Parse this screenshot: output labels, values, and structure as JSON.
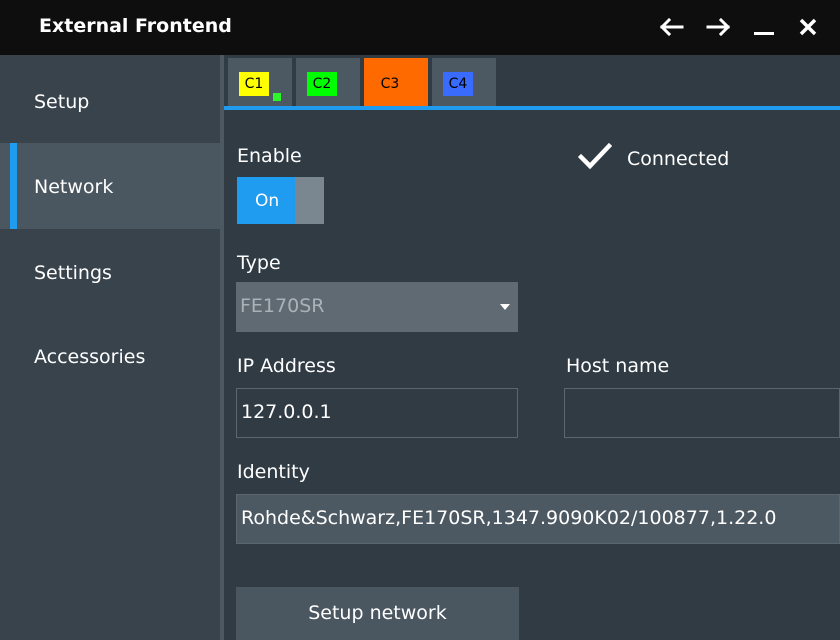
{
  "window": {
    "title": "External Frontend"
  },
  "titlebar_icons": [
    "arrow-left-icon",
    "arrow-right-icon",
    "minimize-icon",
    "close-icon"
  ],
  "sidebar": {
    "items": [
      {
        "label": "Setup",
        "active": false
      },
      {
        "label": "Network",
        "active": true
      },
      {
        "label": "Settings",
        "active": false
      },
      {
        "label": "Accessories",
        "active": false
      }
    ]
  },
  "tabs": [
    {
      "label": "C1",
      "color": "#ffff00",
      "active": false
    },
    {
      "label": "C2",
      "color": "#00ff00",
      "active": false
    },
    {
      "label": "C3",
      "color": "#ff6a00",
      "active": true
    },
    {
      "label": "C4",
      "color": "#3a6bff",
      "active": false
    }
  ],
  "form": {
    "enable_label": "Enable",
    "toggle_value": "On",
    "status_text": "Connected",
    "type_label": "Type",
    "type_value": "FE170SR",
    "ip_label": "IP Address",
    "ip_value": "127.0.0.1",
    "host_label": "Host name",
    "host_value": "",
    "identity_label": "Identity",
    "identity_value": "Rohde&Schwarz,FE170SR,1347.9090K02/100877,1.22.0",
    "setup_button": "Setup network"
  },
  "colors": {
    "accent": "#1f9bf0",
    "background": "#303b44",
    "titlebar": "#0e0e0e"
  }
}
